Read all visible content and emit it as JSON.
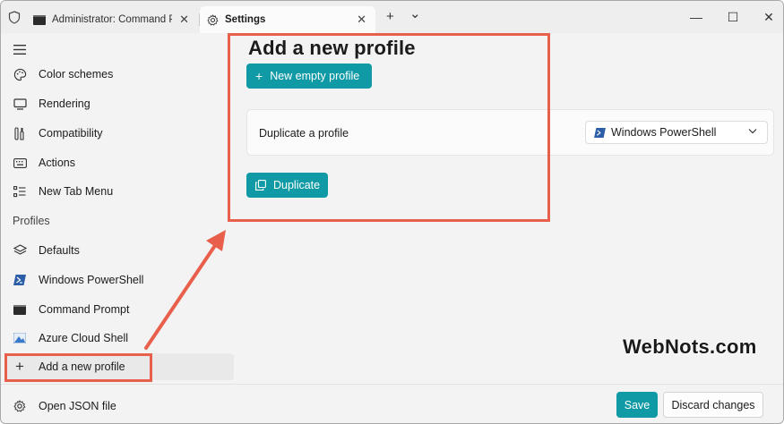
{
  "tabs": [
    {
      "label": "Administrator: Command Pr",
      "close": "✕"
    },
    {
      "label": "Settings",
      "close": "✕"
    }
  ],
  "tabstrip": {
    "new_tab": "+",
    "dropdown": "⌄"
  },
  "window_controls": {
    "minimize": "—",
    "maximize": "☐",
    "close": "✕"
  },
  "sidebar": {
    "items": [
      {
        "label": "Color schemes",
        "icon": "palette-icon"
      },
      {
        "label": "Rendering",
        "icon": "monitor-icon"
      },
      {
        "label": "Compatibility",
        "icon": "tools-icon"
      },
      {
        "label": "Actions",
        "icon": "keyboard-icon"
      },
      {
        "label": "New Tab Menu",
        "icon": "list-icon"
      }
    ],
    "profiles_header": "Profiles",
    "profiles": [
      {
        "label": "Defaults",
        "icon": "layers-icon"
      },
      {
        "label": "Windows PowerShell",
        "icon": "powershell-icon"
      },
      {
        "label": "Command Prompt",
        "icon": "cmd-icon"
      },
      {
        "label": "Azure Cloud Shell",
        "icon": "azure-icon"
      }
    ],
    "add_profile": {
      "label": "Add a new profile",
      "icon": "plus-icon"
    },
    "open_json": {
      "label": "Open JSON file",
      "icon": "gear-icon"
    }
  },
  "main": {
    "title": "Add a new profile",
    "new_empty_button": "New empty profile",
    "duplicate_label": "Duplicate a profile",
    "duplicate_selected": "Windows PowerShell",
    "duplicate_button": "Duplicate"
  },
  "footer": {
    "save": "Save",
    "discard": "Discard changes"
  },
  "watermark": "WebNots.com",
  "colors": {
    "accent": "#0f9aa6",
    "annotation": "#e8604c",
    "background": "#f3f3f3"
  }
}
